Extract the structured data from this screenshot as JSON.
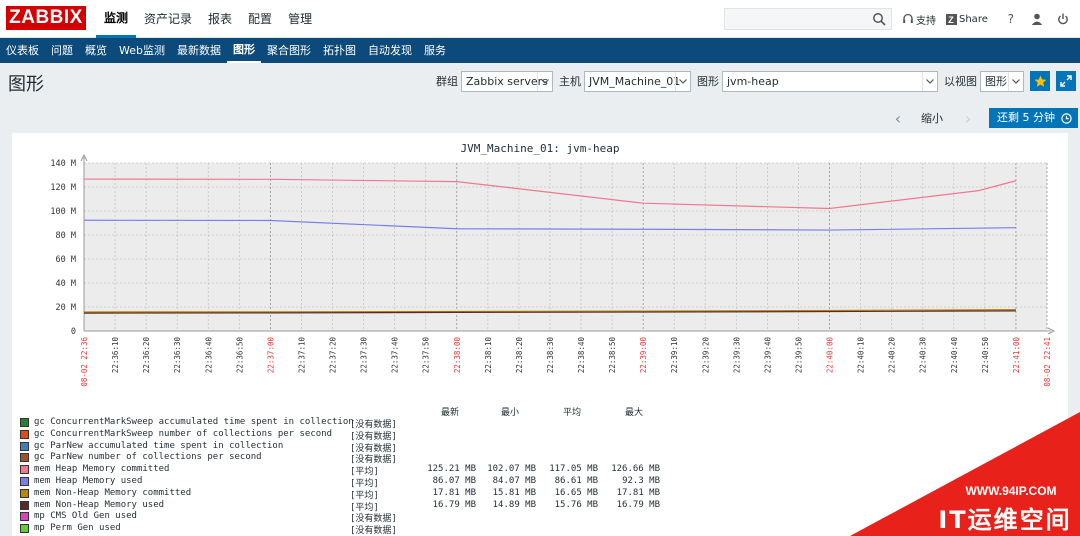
{
  "app": {
    "logo": "ZABBIX"
  },
  "main_nav": [
    "监测",
    "资产记录",
    "报表",
    "配置",
    "管理"
  ],
  "main_nav_active": 0,
  "top_links": {
    "support": "支持",
    "share": "Share",
    "help": "?"
  },
  "search": {
    "value": "",
    "placeholder": ""
  },
  "sub_nav": [
    "仪表板",
    "问题",
    "概览",
    "Web监测",
    "最新数据",
    "图形",
    "聚合图形",
    "拓扑图",
    "自动发现",
    "服务"
  ],
  "sub_nav_active": 5,
  "page": {
    "title": "图形"
  },
  "filters": {
    "group_label": "群组",
    "group_value": "Zabbix servers",
    "host_label": "主机",
    "host_value": "JVM_Machine_01",
    "graph_label": "图形",
    "graph_value": "jvm-heap",
    "view_label": "以视图",
    "view_value": "图形"
  },
  "time_controls": {
    "zoom_out": "缩小",
    "period": "还剩 5 分钟"
  },
  "colors": {
    "accent": "#0275b8",
    "subnav_bg": "#0b4a7a",
    "logo": "#d40000"
  },
  "chart_data": {
    "type": "line",
    "title": "JVM_Machine_01: jvm-heap",
    "y_ticks": [
      "0",
      "20 M",
      "40 M",
      "60 M",
      "80 M",
      "100 M",
      "120 M",
      "140 M"
    ],
    "ylim": [
      0,
      140
    ],
    "x_ticks": [
      {
        "label": "08-02 22:36",
        "red": true
      },
      {
        "label": "22:36:10",
        "red": false
      },
      {
        "label": "22:36:20",
        "red": false
      },
      {
        "label": "22:36:30",
        "red": false
      },
      {
        "label": "22:36:40",
        "red": false
      },
      {
        "label": "22:36:50",
        "red": false
      },
      {
        "label": "22:37:00",
        "red": true
      },
      {
        "label": "22:37:10",
        "red": false
      },
      {
        "label": "22:37:20",
        "red": false
      },
      {
        "label": "22:37:30",
        "red": false
      },
      {
        "label": "22:37:40",
        "red": false
      },
      {
        "label": "22:37:50",
        "red": false
      },
      {
        "label": "22:38:00",
        "red": true
      },
      {
        "label": "22:38:10",
        "red": false
      },
      {
        "label": "22:38:20",
        "red": false
      },
      {
        "label": "22:38:30",
        "red": false
      },
      {
        "label": "22:38:40",
        "red": false
      },
      {
        "label": "22:38:50",
        "red": false
      },
      {
        "label": "22:39:00",
        "red": true
      },
      {
        "label": "22:39:10",
        "red": false
      },
      {
        "label": "22:39:20",
        "red": false
      },
      {
        "label": "22:39:30",
        "red": false
      },
      {
        "label": "22:39:40",
        "red": false
      },
      {
        "label": "22:39:50",
        "red": false
      },
      {
        "label": "22:40:00",
        "red": true
      },
      {
        "label": "22:40:10",
        "red": false
      },
      {
        "label": "22:40:20",
        "red": false
      },
      {
        "label": "22:40:30",
        "red": false
      },
      {
        "label": "22:40:40",
        "red": false
      },
      {
        "label": "22:40:50",
        "red": false
      },
      {
        "label": "22:41:00",
        "red": true
      },
      {
        "label": "08-02 22:41",
        "red": true
      }
    ],
    "series": [
      {
        "name": "mem Heap Memory committed",
        "color": "#f07890",
        "x": [
          0,
          60,
          120,
          180,
          240,
          288,
          300
        ],
        "y": [
          126.6,
          126.4,
          124.5,
          106.5,
          102.1,
          117,
          125.2
        ]
      },
      {
        "name": "mem Heap Memory used",
        "color": "#7a7ee6",
        "x": [
          0,
          60,
          120,
          180,
          240,
          300
        ],
        "y": [
          92.3,
          92.1,
          85.2,
          84.8,
          84.1,
          86.1
        ]
      },
      {
        "name": "mem Non-Heap Memory committed",
        "color": "#b8860b",
        "x": [
          0,
          60,
          120,
          180,
          240,
          300
        ],
        "y": [
          15.9,
          16.0,
          16.3,
          16.6,
          17.1,
          17.8
        ]
      },
      {
        "name": "mem Non-Heap Memory used",
        "color": "#5a2a2a",
        "x": [
          0,
          60,
          120,
          180,
          240,
          300
        ],
        "y": [
          14.9,
          15.1,
          15.5,
          15.8,
          16.2,
          16.8
        ]
      }
    ],
    "legend_headers": [
      "最新",
      "最小",
      "平均",
      "最大"
    ],
    "legend": [
      {
        "name": "gc ConcurrentMarkSweep accumulated time spent in collection",
        "color": "#2e7d32",
        "func": "[没有数据]",
        "last": "",
        "min": "",
        "avg": "",
        "max": ""
      },
      {
        "name": "gc ConcurrentMarkSweep number of collections per second",
        "color": "#e64a19",
        "func": "[没有数据]",
        "last": "",
        "min": "",
        "avg": "",
        "max": ""
      },
      {
        "name": "gc ParNew accumulated time spent in collection",
        "color": "#3f7fb5",
        "func": "[没有数据]",
        "last": "",
        "min": "",
        "avg": "",
        "max": ""
      },
      {
        "name": "gc ParNew number of collections per second",
        "color": "#a0522d",
        "func": "[没有数据]",
        "last": "",
        "min": "",
        "avg": "",
        "max": ""
      },
      {
        "name": "mem Heap Memory committed",
        "color": "#f07890",
        "func": "[平均]",
        "last": "125.21 MB",
        "min": "102.07 MB",
        "avg": "117.05 MB",
        "max": "126.66 MB"
      },
      {
        "name": "mem Heap Memory used",
        "color": "#7a7ee6",
        "func": "[平均]",
        "last": "86.07 MB",
        "min": "84.07 MB",
        "avg": "86.61 MB",
        "max": "92.3 MB"
      },
      {
        "name": "mem Non-Heap Memory committed",
        "color": "#b8860b",
        "func": "[平均]",
        "last": "17.81 MB",
        "min": "15.81 MB",
        "avg": "16.65 MB",
        "max": "17.81 MB"
      },
      {
        "name": "mem Non-Heap Memory used",
        "color": "#5a2a2a",
        "func": "[平均]",
        "last": "16.79 MB",
        "min": "14.89 MB",
        "avg": "15.76 MB",
        "max": "16.79 MB"
      },
      {
        "name": "mp CMS Old Gen used",
        "color": "#e040c0",
        "func": "[没有数据]",
        "last": "",
        "min": "",
        "avg": "",
        "max": ""
      },
      {
        "name": "mp Perm Gen used",
        "color": "#66cc33",
        "func": "[没有数据]",
        "last": "",
        "min": "",
        "avg": "",
        "max": ""
      }
    ]
  },
  "watermark": {
    "url": "WWW.94IP.COM",
    "name": "IT运维空间"
  }
}
